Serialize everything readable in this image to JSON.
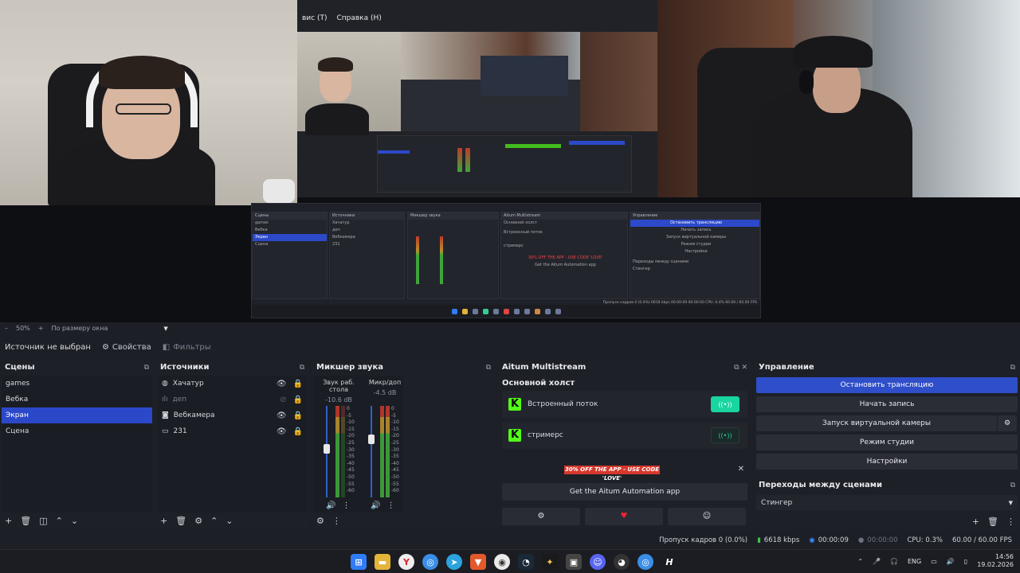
{
  "preview": {
    "inner_menu": [
      "вис (T)",
      "Справка (H)"
    ],
    "mini_obs": {
      "scenes_header": "Сцены",
      "sources_header": "Источники",
      "mixer_header": "Микшер звука",
      "aitum_header": "Aitum Multistream",
      "control_header": "Управление",
      "scenes": [
        "games",
        "Вебка",
        "Экран",
        "Сцена"
      ],
      "sources": [
        "Хачатур",
        "деп",
        "Вебкамера",
        "231"
      ],
      "aitum_main": "Основной холст",
      "aitum_outputs": [
        "Встроенный поток",
        "стримерс"
      ],
      "promo": "30% OFF THE APP - USE CODE 'LOVE'",
      "get_app": "Get the Aitum Automation app",
      "controls": [
        "Остановить трансляцию",
        "Начать запись",
        "Запуск виртуальной камеры",
        "Режим студии",
        "Настройки"
      ],
      "transitions_header": "Переходы между сценами",
      "transition": "Стингер",
      "status": "Пропуск кадров 0 (0.0%)   6618 kbps   00:00:09   00:00:00   CPU: 0.4%   60.00 / 60.00 FPS"
    }
  },
  "zoom": {
    "minus": "–",
    "value": "50%",
    "plus": "+",
    "fit": "По размеру окна",
    "dropdown": "▼"
  },
  "source_toolbar": {
    "no_source": "Источник не выбран",
    "properties": "Свойства",
    "filters": "Фильтры"
  },
  "scenes": {
    "title": "Сцены",
    "items": [
      {
        "label": "games",
        "selected": false
      },
      {
        "label": "Вебка",
        "selected": false
      },
      {
        "label": "Экран",
        "selected": true
      },
      {
        "label": "Сцена",
        "selected": false
      }
    ]
  },
  "sources": {
    "title": "Источники",
    "items": [
      {
        "label": "Хачатур",
        "icon": "browser-icon",
        "visible": true
      },
      {
        "label": "деп",
        "icon": "audio-icon",
        "visible": false
      },
      {
        "label": "Вебкамера",
        "icon": "camera-icon",
        "visible": true
      },
      {
        "label": "231",
        "icon": "display-icon",
        "visible": true
      }
    ]
  },
  "mixer": {
    "title": "Микшер звука",
    "channels": [
      {
        "name": "Звук раб. стола",
        "db": "-10.6 dB"
      },
      {
        "name": "Микр/доп",
        "db": "-4.5 dB"
      }
    ],
    "scale": [
      "0",
      "-5",
      "-10",
      "-15",
      "-20",
      "-25",
      "-30",
      "-35",
      "-40",
      "-45",
      "-50",
      "-55",
      "-60"
    ]
  },
  "aitum": {
    "title": "Aitum Multistream",
    "main_canvas": "Основной холст",
    "outputs": [
      {
        "label": "Встроенный поток",
        "live": true
      },
      {
        "label": "стримерс",
        "live": false
      }
    ],
    "promo": "30% OFF THE APP - USE CODE 'LOVE'",
    "get_app": "Get the Aitum Automation app"
  },
  "control": {
    "title": "Управление",
    "stop_stream": "Остановить трансляцию",
    "start_record": "Начать запись",
    "virtual_cam": "Запуск виртуальной камеры",
    "studio_mode": "Режим студии",
    "settings": "Настройки"
  },
  "transitions": {
    "title": "Переходы между сценами",
    "selected": "Стингер"
  },
  "status": {
    "dropped": "Пропуск кадров 0 (0.0%)",
    "bitrate": "6618 kbps",
    "stream_time": "00:00:09",
    "record_time": "00:00:00",
    "cpu": "CPU: 0.3%",
    "fps": "60.00 / 60.00 FPS"
  },
  "taskbar": {
    "lang": "ENG",
    "time": "14:56",
    "date": "19.02.2026"
  },
  "colors": {
    "accent": "#2b48c9",
    "live": "#18d6a0",
    "kick": "#53fc18",
    "promo": "#d6382d"
  }
}
